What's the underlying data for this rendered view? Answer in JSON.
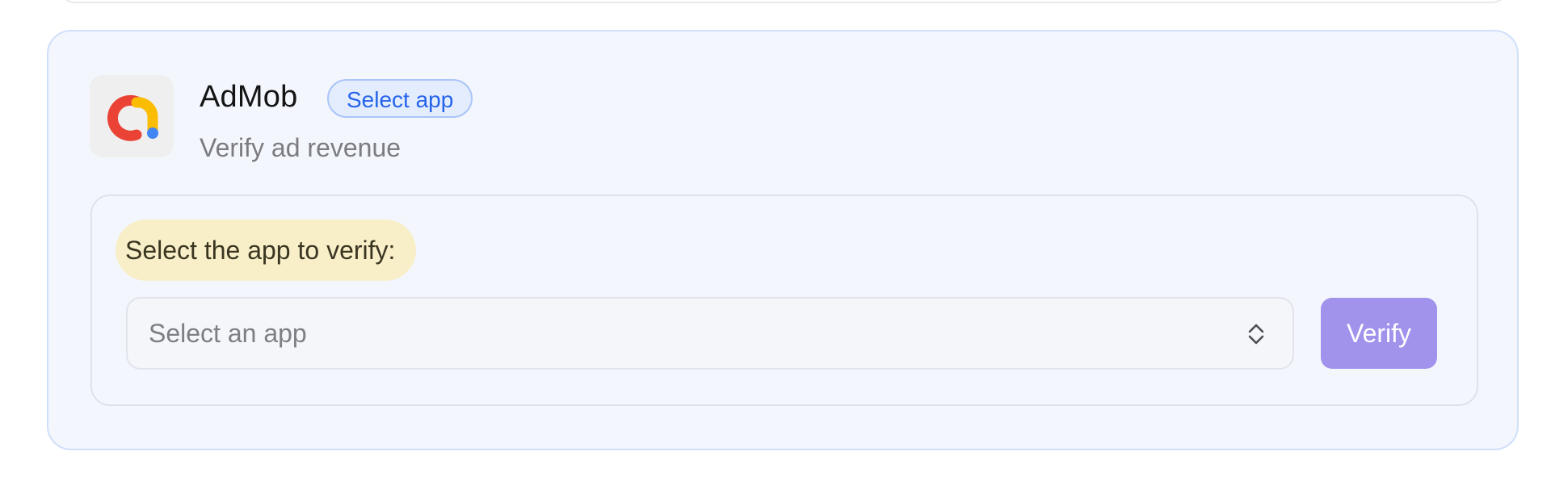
{
  "integration": {
    "name": "AdMob",
    "status_badge": "Select app",
    "description": "Verify ad revenue",
    "icon": "admob-logo-icon",
    "brand_colors": {
      "red": "#ea4335",
      "yellow": "#fbbc04",
      "blue": "#4285f4"
    }
  },
  "verification": {
    "prompt": "Select the app to verify:",
    "app_select": {
      "placeholder": "Select an app",
      "icon": "select-arrows-icon"
    },
    "verify_label": "Verify"
  },
  "colors": {
    "card_background": "#f3f6fd",
    "badge_text": "#2563eb",
    "prompt_highlight": "#f8efc9",
    "verify_button": "#a192ec"
  }
}
